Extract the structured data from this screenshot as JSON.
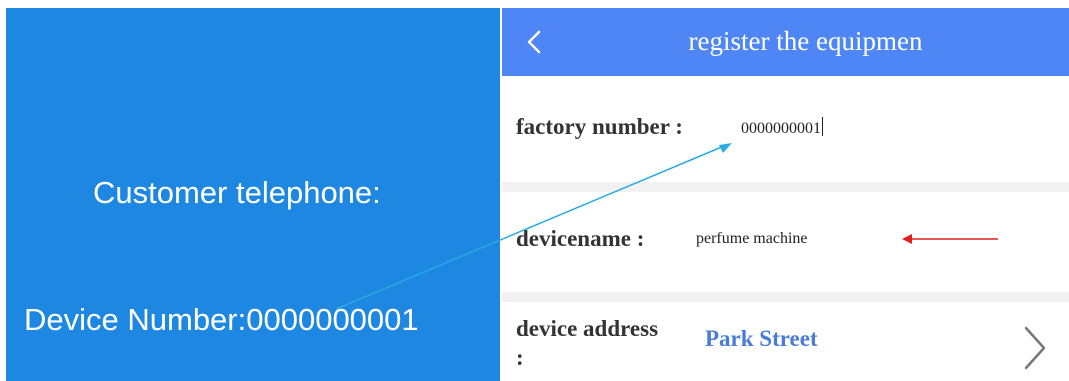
{
  "left_panel": {
    "customer_telephone": "Customer telephone:",
    "device_number": "Device Number:0000000001",
    "background_color": "#1e87e2"
  },
  "header": {
    "back_icon": "chevron-left-icon",
    "title": "register the equipmen",
    "background_color": "#4f86f5"
  },
  "form": {
    "factory_number": {
      "label": "factory number :",
      "value": "0000000001"
    },
    "device_name": {
      "label": "devicename :",
      "value": "perfume machine"
    },
    "device_address": {
      "label_line1": "device address",
      "label_line2": ":",
      "value": "Park Street",
      "icon": "chevron-right-icon"
    }
  },
  "annotations": {
    "blue_arrow_color": "#29aae1",
    "red_arrow_color": "#e02020"
  }
}
